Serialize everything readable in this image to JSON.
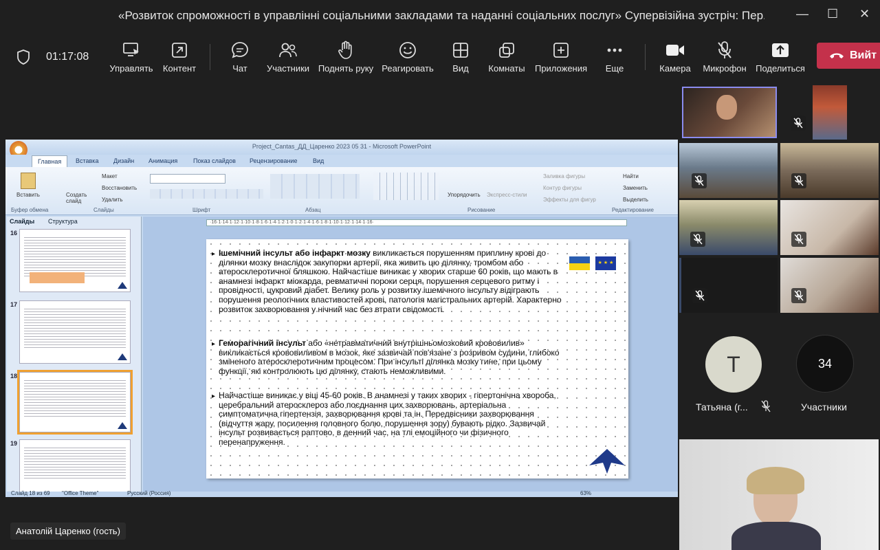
{
  "window": {
    "title": "«Розвиток спроможності в управлінні соціальними закладами та наданні соціальних послуг» Супервізійна зустріч: Пер..."
  },
  "meeting": {
    "timer": "01:17:08",
    "leave_label": "Вийт"
  },
  "toolbar": {
    "items": [
      {
        "label": "Управлять",
        "icon": "monitor-cursor-icon"
      },
      {
        "label": "Контент",
        "icon": "share-content-icon"
      },
      {
        "label": "Чат",
        "icon": "chat-icon"
      },
      {
        "label": "Участники",
        "icon": "people-icon"
      },
      {
        "label": "Поднять руку",
        "icon": "hand-icon"
      },
      {
        "label": "Реагировать",
        "icon": "smiley-icon"
      },
      {
        "label": "Вид",
        "icon": "grid-icon"
      },
      {
        "label": "Комнаты",
        "icon": "rooms-icon"
      },
      {
        "label": "Приложения",
        "icon": "plus-square-icon"
      },
      {
        "label": "Еще",
        "icon": "more-icon"
      },
      {
        "label": "Камера",
        "icon": "camera-icon"
      },
      {
        "label": "Микрофон",
        "icon": "mic-off-icon"
      },
      {
        "label": "Поделиться",
        "icon": "share-up-icon"
      }
    ]
  },
  "powerpoint": {
    "title": "Project_Cantas_ДД_Царенко 2023 05 31 - Microsoft PowerPoint",
    "tabs": [
      "Главная",
      "Вставка",
      "Дизайн",
      "Анимация",
      "Показ слайдов",
      "Рецензирование",
      "Вид"
    ],
    "groups": [
      "Буфер обмена",
      "Слайды",
      "Шрифт",
      "Абзац",
      "Рисование",
      "Редактирование"
    ],
    "ribbon": {
      "paste": "Вставить",
      "new_slide": "Создать слайд",
      "layout": "Макет",
      "reset": "Восстановить",
      "delete": "Удалить",
      "arrange": "Упорядочить",
      "quick_styles": "Экспресс-стили",
      "shape_fill": "Заливка фигуры",
      "shape_outline": "Контур фигуры",
      "shape_effects": "Эффекты для фигур",
      "find": "Найти",
      "replace": "Заменить",
      "select": "Выделить"
    },
    "pane_tabs": [
      "Слайды",
      "Структура"
    ],
    "thumbs": [
      {
        "num": "16"
      },
      {
        "num": "17"
      },
      {
        "num": "18"
      },
      {
        "num": "19"
      }
    ],
    "status": {
      "slide": "Слайд 18 из 69",
      "theme": "\"Office Theme\"",
      "lang": "Русский (Россия)",
      "zoom": "63%"
    },
    "ruler": "·16·1·14·1·12·1·10·1·8·1·6·1·4·1·2·1·0·1·2·1·4·1·6·1·8·1·10·1·12·1·14·1·16·"
  },
  "slide": {
    "p1_bold": "Ішемічний інсульт або інфаркт мозку",
    "p1_text": " викликається порушенням приплину крові до ділянки мозку внаслідок закупорки артерії, яка живить цю ділянку, тромбом або атеросклеротичної бляшкою. Найчастіше виникає у хворих старше 60 років, що мають в анамнезі інфаркт міокарда, ревматичні пороки серця, порушення серцевого ритму і провідності, цукровий діабет. Велику роль у розвитку ішемічного інсульту відіграють порушення реологічних властивостей крові, патологія магістральних артерій. Характерно розвиток захворювання у нічний час без втрати свідомості.",
    "p2_bold": "Геморагічний інсульт",
    "p2_text": " або «нетравматичний внутрішньомозковий крововилив» викликається крововиливом в мозок, яке зазвичай пов'язане з розривом судини, глибоко зміненого атеросклеротичним процесом. При інсульті ділянка мозку гине, при цьому функції, які контролюють цю ділянку, стають неможливими.",
    "p3_text": "Найчастіше виникає у віці 45-60 років. В анамнезі у таких хворих - гіпертонічна хвороба, церебральний атеросклероз або поєднання цих захворювань, артеріальна симптоматична гіпертензія, захворювання крові та ін. Передвісники захворювання (відчуття жару, посилення головного болю, порушення зору) бувають рідко. Зазвичай інсульт розвивається раптово, в денний час, на тлі емоційного чи фізичного перенапруження.",
    "eu_flag": "★ ★ ★"
  },
  "presenter": {
    "name": "Анатолій Царенко (гость)"
  },
  "participants": {
    "avatar_letter": "Т",
    "avatar_name": "Татьяна (г...",
    "count": "34",
    "count_label": "Участники"
  }
}
